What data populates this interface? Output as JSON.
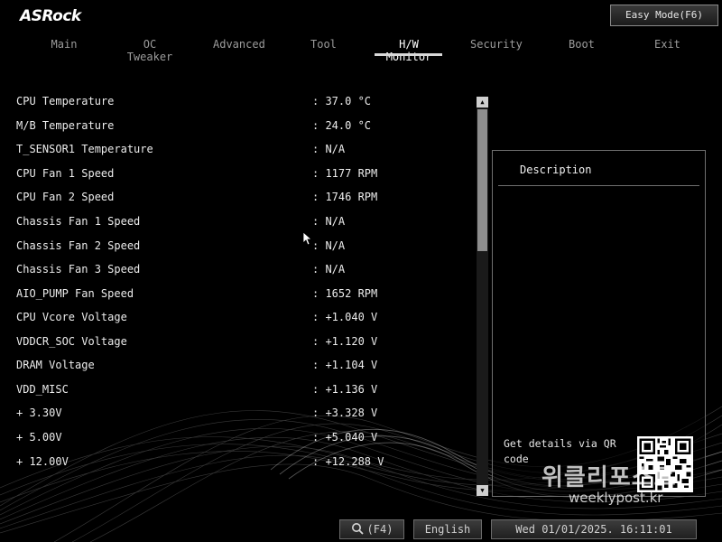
{
  "brand": {
    "logo": "ASRock"
  },
  "header": {
    "easy_mode_label": "Easy Mode(F6)"
  },
  "tabs": [
    {
      "label": "Main"
    },
    {
      "label": "OC Tweaker"
    },
    {
      "label": "Advanced"
    },
    {
      "label": "Tool"
    },
    {
      "label": "H/W Monitor",
      "active": true
    },
    {
      "label": "Security"
    },
    {
      "label": "Boot"
    },
    {
      "label": "Exit"
    }
  ],
  "monitor": {
    "rows": [
      {
        "label": "CPU Temperature",
        "value": ": 37.0 °C"
      },
      {
        "label": "M/B Temperature",
        "value": ": 24.0 °C"
      },
      {
        "label": "T_SENSOR1 Temperature",
        "value": ": N/A"
      },
      {
        "label": "CPU Fan 1 Speed",
        "value": ": 1177 RPM"
      },
      {
        "label": "CPU Fan 2 Speed",
        "value": ": 1746 RPM"
      },
      {
        "label": "Chassis Fan 1 Speed",
        "value": ": N/A"
      },
      {
        "label": "Chassis Fan 2 Speed",
        "value": ": N/A"
      },
      {
        "label": "Chassis Fan 3 Speed",
        "value": ": N/A"
      },
      {
        "label": "AIO_PUMP Fan Speed",
        "value": ": 1652 RPM"
      },
      {
        "label": "CPU Vcore Voltage",
        "value": ": +1.040 V"
      },
      {
        "label": "VDDCR_SOC Voltage",
        "value": ": +1.120 V"
      },
      {
        "label": "DRAM Voltage",
        "value": ": +1.104 V"
      },
      {
        "label": "VDD_MISC",
        "value": ": +1.136 V"
      },
      {
        "label": "+ 3.30V",
        "value": ": +3.328 V"
      },
      {
        "label": "+ 5.00V",
        "value": ": +5.040 V"
      },
      {
        "label": "+ 12.00V",
        "value": ": +12.288 V"
      }
    ]
  },
  "description": {
    "title": "Description",
    "qr_text": "Get details via QR code"
  },
  "footer": {
    "search_label": "(F4)",
    "language": "English",
    "datetime": "Wed 01/01/2025. 16:11:01"
  },
  "watermark": {
    "brand": "위클리포스트",
    "url": "weeklypost.kr"
  },
  "colors": {
    "background": "#000000",
    "text": "#e6e6e6",
    "tab_inactive": "#9c9c9c",
    "active_tab": "#ffffff"
  }
}
